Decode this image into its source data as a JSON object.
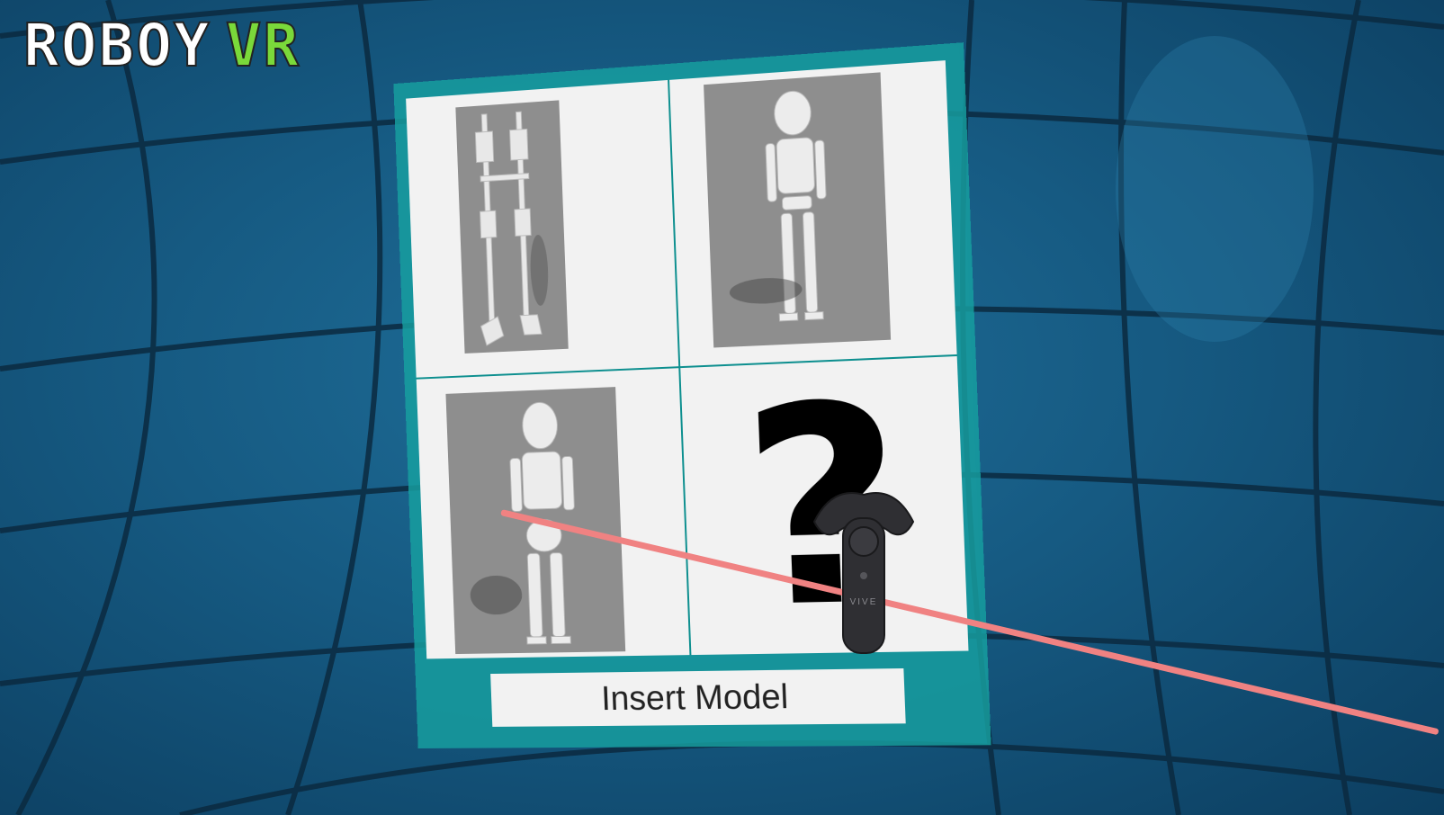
{
  "logo": {
    "word1": "ROBOY",
    "word2": "VR",
    "word1_color": "#ffffff",
    "word2_color": "#7ad93a"
  },
  "model_menu": {
    "panel_color": "#16a0a0",
    "tiles": [
      {
        "name": "Legs model",
        "kind": "thumbnail",
        "icon": "leg-rig-icon"
      },
      {
        "name": "Roboy skeleton model",
        "kind": "thumbnail",
        "icon": "robot-skeleton-icon"
      },
      {
        "name": "Roboy model",
        "kind": "thumbnail",
        "icon": "robot-skeleton-icon"
      },
      {
        "name": "Unknown model",
        "kind": "placeholder",
        "glyph": "?"
      }
    ],
    "insert_button_label": "Insert Model"
  },
  "controller": {
    "brand_text": "VIVE",
    "icon": "vive-controller-icon"
  },
  "pointer": {
    "color": "#f08282"
  }
}
